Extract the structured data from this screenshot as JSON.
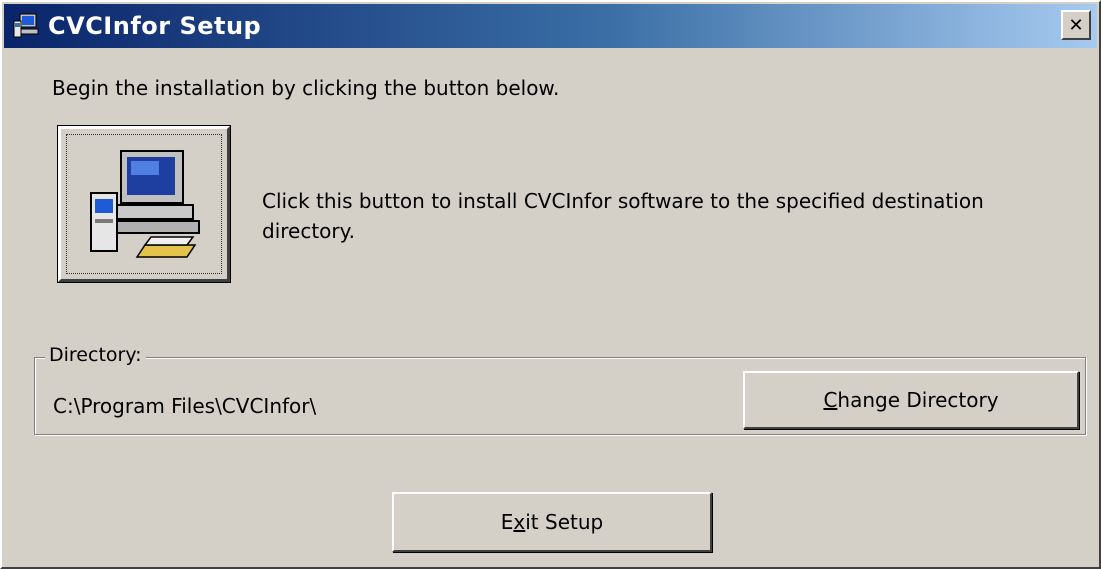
{
  "window": {
    "title": "CVCInfor Setup",
    "close_glyph": "✕",
    "colors": {
      "face": "#d4d0c8",
      "title_start": "#0a246a",
      "title_end": "#a6caf0"
    }
  },
  "instruction": "Begin the installation by clicking the button below.",
  "install": {
    "icon": "computer-setup-icon",
    "description": "Click this button to install CVCInfor software to the specified destination directory."
  },
  "directory": {
    "legend": "Directory:",
    "path": "C:\\Program Files\\CVCInfor\\",
    "change_button": "Change Directory"
  },
  "exit_button": {
    "pre": "E",
    "mnemonic": "x",
    "post": "it Setup"
  }
}
